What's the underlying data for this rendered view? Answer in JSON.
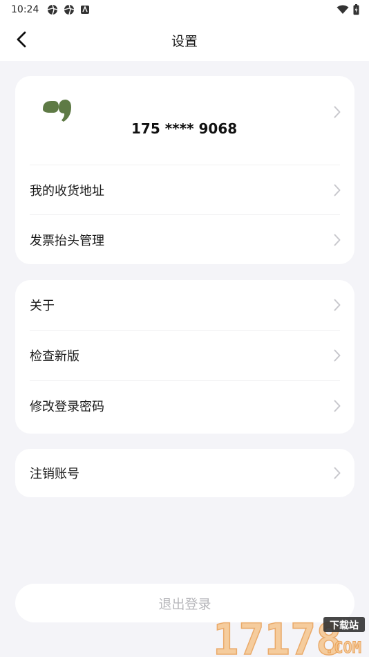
{
  "status_bar": {
    "time": "10:24"
  },
  "header": {
    "title": "设置"
  },
  "profile": {
    "phone": "175 **** 9068"
  },
  "card_account": {
    "items": [
      {
        "label": "我的收货地址"
      },
      {
        "label": "发票抬头管理"
      }
    ]
  },
  "card_app": {
    "items": [
      {
        "label": "关于"
      },
      {
        "label": "检查新版"
      },
      {
        "label": "修改登录密码"
      }
    ]
  },
  "card_danger": {
    "items": [
      {
        "label": "注销账号"
      }
    ]
  },
  "logout": {
    "label": "退出登录"
  },
  "watermark": {
    "brand": "17178",
    "tag": "下载站",
    "domain": ".COM"
  },
  "colors": {
    "background": "#f4f4f8",
    "card": "#ffffff",
    "avatar": "#5e7a45",
    "chevron": "#c7c7cc",
    "logout_text": "#b8b8bc"
  }
}
